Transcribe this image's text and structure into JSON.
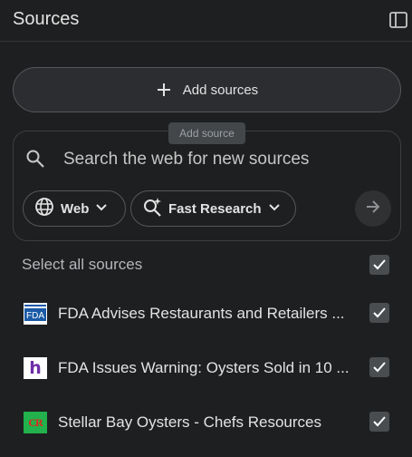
{
  "header": {
    "title": "Sources",
    "panel_toggle_icon": "side-panel-icon"
  },
  "add_sources": {
    "label": "Add sources",
    "icon": "plus-icon",
    "tooltip": "Add source"
  },
  "search": {
    "placeholder": "Search the web for new sources",
    "icon": "search-icon",
    "chips": [
      {
        "label": "Web",
        "icon": "globe-icon"
      },
      {
        "label": "Fast Research",
        "icon": "sparkle-search-icon"
      }
    ],
    "submit_icon": "arrow-right-icon"
  },
  "select_all": {
    "label": "Select all sources",
    "checked": true
  },
  "sources": [
    {
      "title": "FDA Advises Restaurants and Retailers ...",
      "favicon_text": "FDA",
      "favicon": "fda-favicon",
      "checked": true
    },
    {
      "title": "FDA Issues Warning: Oysters Sold in 10 ...",
      "favicon_text": "h",
      "favicon": "h-favicon",
      "checked": true
    },
    {
      "title": "Stellar Bay Oysters - Chefs Resources",
      "favicon_text": "CR",
      "favicon": "cr-favicon",
      "checked": true
    }
  ],
  "colors": {
    "background": "#1e1f20",
    "button_bg": "#2b2d30",
    "border": "#55575a",
    "text": "#e3e3e3",
    "muted_text": "#b4b7bb",
    "checkbox": "#4a4d50"
  }
}
